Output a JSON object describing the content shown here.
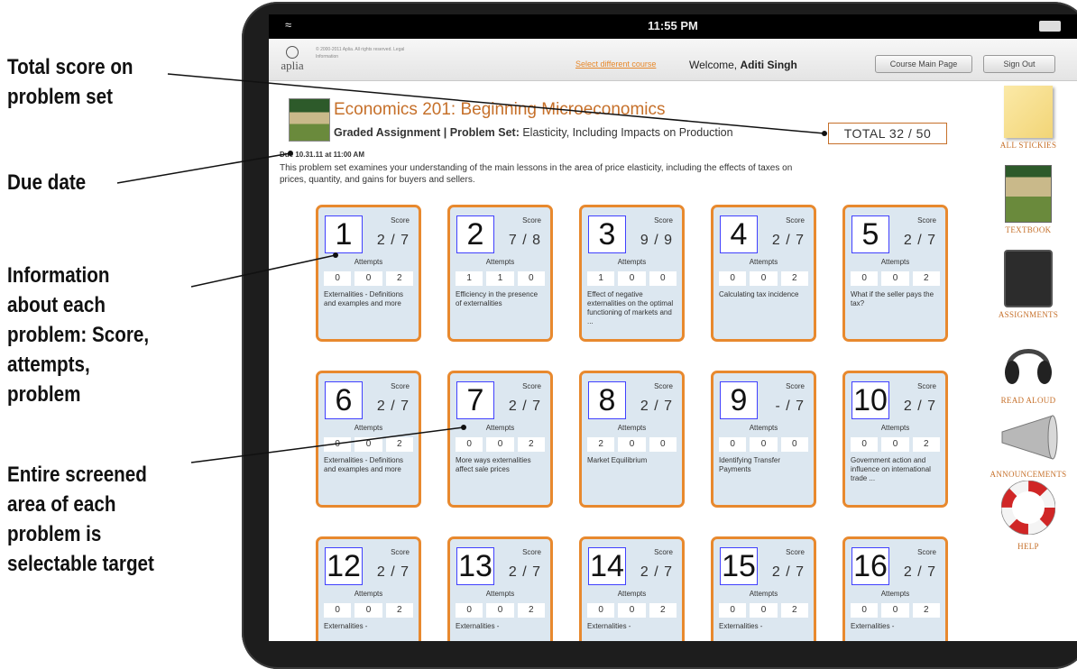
{
  "annotations": {
    "total_score": [
      "Total score on",
      "problem set"
    ],
    "due_date": [
      "Due date"
    ],
    "problem_info": [
      "Information",
      "about each",
      "problem: Score,",
      "attempts,",
      "problem"
    ],
    "selectable": [
      "Entire screened",
      "area of each",
      "problem is",
      "selectable target"
    ]
  },
  "statusbar": {
    "time": "11:55 PM"
  },
  "header": {
    "logo": "aplia",
    "copyright": "© 2000-2011 Aplia. All rights reserved. Legal Information",
    "select_course": "Select different course",
    "welcome_prefix": "Welcome,",
    "user_name": "Aditi Singh",
    "course_main_page": "Course Main Page",
    "sign_out": "Sign Out"
  },
  "course": {
    "title": "Economics 201: Beginning Microeconomics",
    "assignment_label": "Graded Assignment | Problem Set:",
    "assignment_name": "Elasticity, Including Impacts on Production",
    "total": "TOTAL  32 / 50",
    "due": "Due 10.31.11 at 11:00 AM",
    "description": "This problem set examines your understanding of the main lessons in the area of price elasticity, including the effects of taxes on prices, quantity, and gains for buyers and sellers."
  },
  "labels": {
    "score": "Score",
    "attempts": "Attempts"
  },
  "problems": [
    {
      "num": "1",
      "score": "2 / 7",
      "attempts": [
        "0",
        "0",
        "2"
      ],
      "title": "Externalities - Definitions and examples and more"
    },
    {
      "num": "2",
      "score": "7 / 8",
      "attempts": [
        "1",
        "1",
        "0"
      ],
      "title": "Efficiency in the presence of externalities"
    },
    {
      "num": "3",
      "score": "9 / 9",
      "attempts": [
        "1",
        "0",
        "0"
      ],
      "title": "Effect of negative externalities on the optimal functioning of markets and ..."
    },
    {
      "num": "4",
      "score": "2 / 7",
      "attempts": [
        "0",
        "0",
        "2"
      ],
      "title": "Calculating tax incidence"
    },
    {
      "num": "5",
      "score": "2 / 7",
      "attempts": [
        "0",
        "0",
        "2"
      ],
      "title": "What if the seller pays the tax?"
    },
    {
      "num": "6",
      "score": "2 / 7",
      "attempts": [
        "0",
        "0",
        "2"
      ],
      "title": "Externalities - Definitions and examples and more"
    },
    {
      "num": "7",
      "score": "2 / 7",
      "attempts": [
        "0",
        "0",
        "2"
      ],
      "title": "More ways externalities affect sale prices"
    },
    {
      "num": "8",
      "score": "2 / 7",
      "attempts": [
        "2",
        "0",
        "0"
      ],
      "title": "Market Equilibrium"
    },
    {
      "num": "9",
      "score": "- / 7",
      "attempts": [
        "0",
        "0",
        "0"
      ],
      "title": "Identifying Transfer Payments"
    },
    {
      "num": "10",
      "score": "2 / 7",
      "attempts": [
        "0",
        "0",
        "2"
      ],
      "title": "Government action and influence on international trade ..."
    },
    {
      "num": "12",
      "score": "2 / 7",
      "attempts": [
        "0",
        "0",
        "2"
      ],
      "title": "Externalities -"
    },
    {
      "num": "13",
      "score": "2 / 7",
      "attempts": [
        "0",
        "0",
        "2"
      ],
      "title": "Externalities -"
    },
    {
      "num": "14",
      "score": "2 / 7",
      "attempts": [
        "0",
        "0",
        "2"
      ],
      "title": "Externalities -"
    },
    {
      "num": "15",
      "score": "2 / 7",
      "attempts": [
        "0",
        "0",
        "2"
      ],
      "title": "Externalities -"
    },
    {
      "num": "16",
      "score": "2 / 7",
      "attempts": [
        "0",
        "0",
        "2"
      ],
      "title": "Externalities -"
    }
  ],
  "sidebar": [
    {
      "label": "All Stickies",
      "icon": "sticky-note-icon"
    },
    {
      "label": "Textbook",
      "icon": "textbook-icon"
    },
    {
      "label": "Assignments",
      "icon": "assignments-icon"
    },
    {
      "label": "Read Aloud",
      "icon": "headphones-icon"
    },
    {
      "label": "Announcements",
      "icon": "megaphone-icon"
    },
    {
      "label": "Help",
      "icon": "lifebuoy-icon"
    }
  ],
  "colors": {
    "accent": "#e8892e",
    "card_bg": "#dce7f0",
    "title": "#c6702a"
  }
}
